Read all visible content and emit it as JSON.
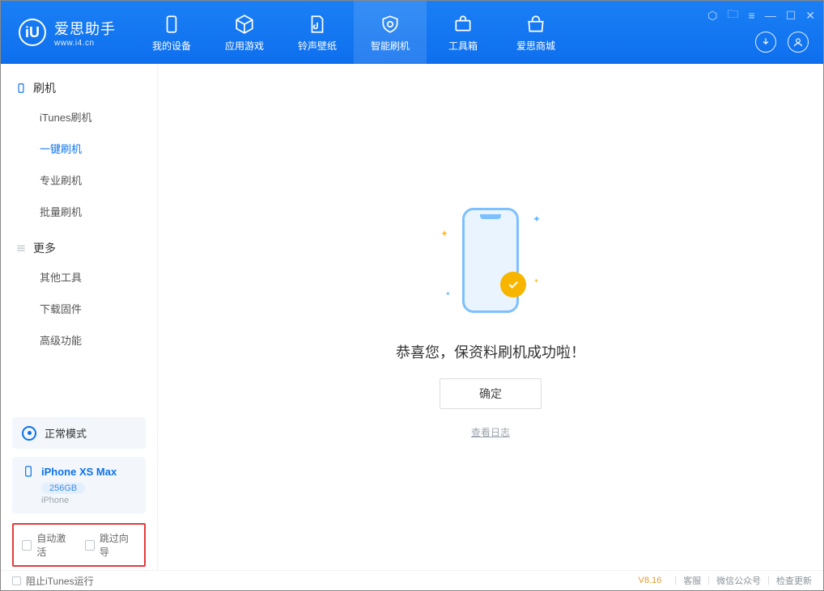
{
  "app": {
    "name": "爱思助手",
    "url": "www.i4.cn",
    "logo_letter": "iU"
  },
  "nav": {
    "items": [
      {
        "label": "我的设备"
      },
      {
        "label": "应用游戏"
      },
      {
        "label": "铃声壁纸"
      },
      {
        "label": "智能刷机"
      },
      {
        "label": "工具箱"
      },
      {
        "label": "爱思商城"
      }
    ],
    "active_index": 3
  },
  "sidebar": {
    "sections": [
      {
        "title": "刷机",
        "items": [
          "iTunes刷机",
          "一键刷机",
          "专业刷机",
          "批量刷机"
        ],
        "active_index": 1
      },
      {
        "title": "更多",
        "items": [
          "其他工具",
          "下载固件",
          "高级功能"
        ]
      }
    ],
    "mode_label": "正常模式",
    "device": {
      "name": "iPhone XS Max",
      "storage": "256GB",
      "type": "iPhone"
    },
    "checkboxes": {
      "auto_activate": "自动激活",
      "skip_guide": "跳过向导"
    }
  },
  "main": {
    "success_message": "恭喜您，保资料刷机成功啦！",
    "ok_button": "确定",
    "view_log": "查看日志"
  },
  "footer": {
    "block_itunes": "阻止iTunes运行",
    "version": "V8.16",
    "links": [
      "客服",
      "微信公众号",
      "检查更新"
    ]
  }
}
